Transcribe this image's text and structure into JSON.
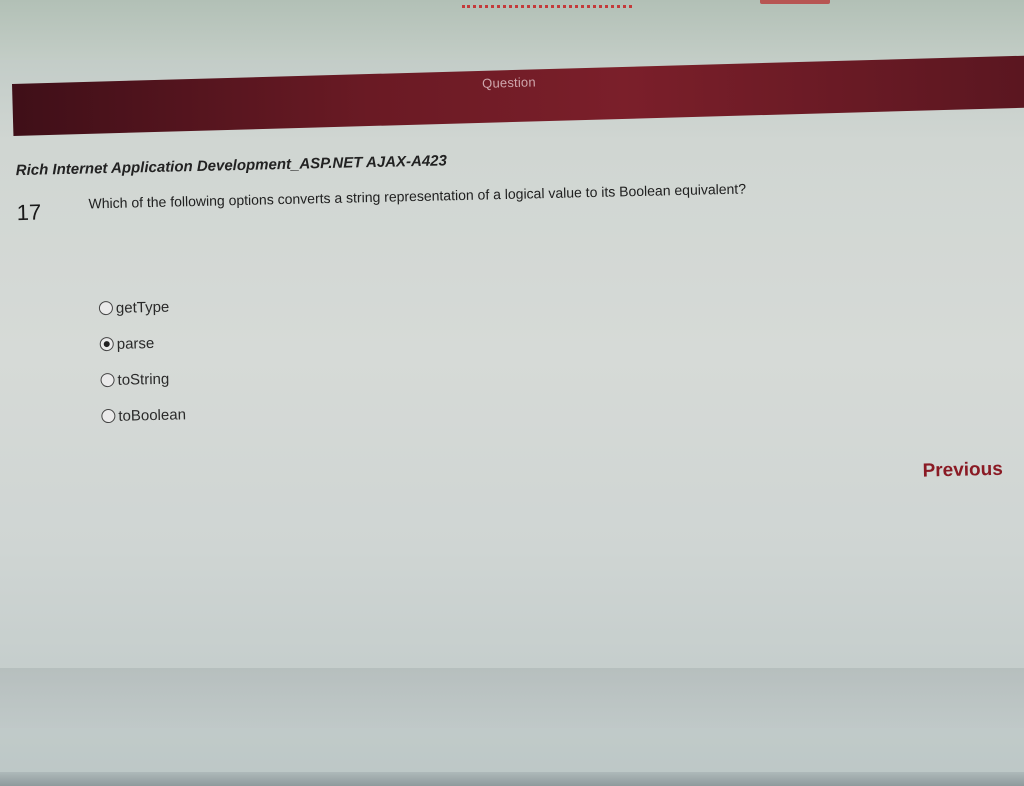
{
  "header": {
    "bar_label": "Question"
  },
  "question": {
    "course_title": "Rich Internet Application Development_ASP.NET AJAX-A423",
    "number": "17",
    "text": "Which of the following options converts a string representation of a logical value to its Boolean equivalent?",
    "options": [
      {
        "label": "getType",
        "selected": false
      },
      {
        "label": "parse",
        "selected": true
      },
      {
        "label": "toString",
        "selected": false
      },
      {
        "label": "toBoolean",
        "selected": false
      }
    ]
  },
  "nav": {
    "previous_label": "Previous"
  },
  "colors": {
    "bar": "#6a1a24",
    "accent": "#8a1a24"
  }
}
